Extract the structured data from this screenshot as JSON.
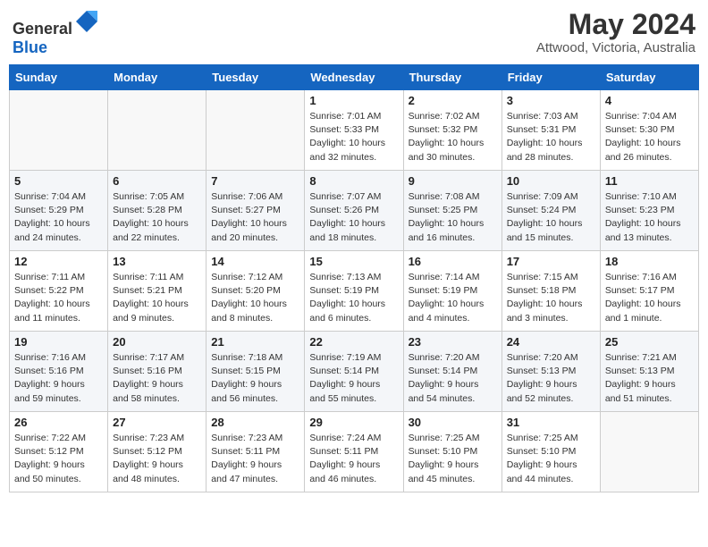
{
  "header": {
    "logo": {
      "general": "General",
      "blue": "Blue"
    },
    "month_year": "May 2024",
    "location": "Attwood, Victoria, Australia"
  },
  "days_of_week": [
    "Sunday",
    "Monday",
    "Tuesday",
    "Wednesday",
    "Thursday",
    "Friday",
    "Saturday"
  ],
  "weeks": [
    [
      {
        "day": "",
        "sunrise": "",
        "sunset": "",
        "daylight": "",
        "empty": true
      },
      {
        "day": "",
        "sunrise": "",
        "sunset": "",
        "daylight": "",
        "empty": true
      },
      {
        "day": "",
        "sunrise": "",
        "sunset": "",
        "daylight": "",
        "empty": true
      },
      {
        "day": "1",
        "sunrise": "Sunrise: 7:01 AM",
        "sunset": "Sunset: 5:33 PM",
        "daylight": "Daylight: 10 hours and 32 minutes.",
        "empty": false
      },
      {
        "day": "2",
        "sunrise": "Sunrise: 7:02 AM",
        "sunset": "Sunset: 5:32 PM",
        "daylight": "Daylight: 10 hours and 30 minutes.",
        "empty": false
      },
      {
        "day": "3",
        "sunrise": "Sunrise: 7:03 AM",
        "sunset": "Sunset: 5:31 PM",
        "daylight": "Daylight: 10 hours and 28 minutes.",
        "empty": false
      },
      {
        "day": "4",
        "sunrise": "Sunrise: 7:04 AM",
        "sunset": "Sunset: 5:30 PM",
        "daylight": "Daylight: 10 hours and 26 minutes.",
        "empty": false
      }
    ],
    [
      {
        "day": "5",
        "sunrise": "Sunrise: 7:04 AM",
        "sunset": "Sunset: 5:29 PM",
        "daylight": "Daylight: 10 hours and 24 minutes.",
        "empty": false
      },
      {
        "day": "6",
        "sunrise": "Sunrise: 7:05 AM",
        "sunset": "Sunset: 5:28 PM",
        "daylight": "Daylight: 10 hours and 22 minutes.",
        "empty": false
      },
      {
        "day": "7",
        "sunrise": "Sunrise: 7:06 AM",
        "sunset": "Sunset: 5:27 PM",
        "daylight": "Daylight: 10 hours and 20 minutes.",
        "empty": false
      },
      {
        "day": "8",
        "sunrise": "Sunrise: 7:07 AM",
        "sunset": "Sunset: 5:26 PM",
        "daylight": "Daylight: 10 hours and 18 minutes.",
        "empty": false
      },
      {
        "day": "9",
        "sunrise": "Sunrise: 7:08 AM",
        "sunset": "Sunset: 5:25 PM",
        "daylight": "Daylight: 10 hours and 16 minutes.",
        "empty": false
      },
      {
        "day": "10",
        "sunrise": "Sunrise: 7:09 AM",
        "sunset": "Sunset: 5:24 PM",
        "daylight": "Daylight: 10 hours and 15 minutes.",
        "empty": false
      },
      {
        "day": "11",
        "sunrise": "Sunrise: 7:10 AM",
        "sunset": "Sunset: 5:23 PM",
        "daylight": "Daylight: 10 hours and 13 minutes.",
        "empty": false
      }
    ],
    [
      {
        "day": "12",
        "sunrise": "Sunrise: 7:11 AM",
        "sunset": "Sunset: 5:22 PM",
        "daylight": "Daylight: 10 hours and 11 minutes.",
        "empty": false
      },
      {
        "day": "13",
        "sunrise": "Sunrise: 7:11 AM",
        "sunset": "Sunset: 5:21 PM",
        "daylight": "Daylight: 10 hours and 9 minutes.",
        "empty": false
      },
      {
        "day": "14",
        "sunrise": "Sunrise: 7:12 AM",
        "sunset": "Sunset: 5:20 PM",
        "daylight": "Daylight: 10 hours and 8 minutes.",
        "empty": false
      },
      {
        "day": "15",
        "sunrise": "Sunrise: 7:13 AM",
        "sunset": "Sunset: 5:19 PM",
        "daylight": "Daylight: 10 hours and 6 minutes.",
        "empty": false
      },
      {
        "day": "16",
        "sunrise": "Sunrise: 7:14 AM",
        "sunset": "Sunset: 5:19 PM",
        "daylight": "Daylight: 10 hours and 4 minutes.",
        "empty": false
      },
      {
        "day": "17",
        "sunrise": "Sunrise: 7:15 AM",
        "sunset": "Sunset: 5:18 PM",
        "daylight": "Daylight: 10 hours and 3 minutes.",
        "empty": false
      },
      {
        "day": "18",
        "sunrise": "Sunrise: 7:16 AM",
        "sunset": "Sunset: 5:17 PM",
        "daylight": "Daylight: 10 hours and 1 minute.",
        "empty": false
      }
    ],
    [
      {
        "day": "19",
        "sunrise": "Sunrise: 7:16 AM",
        "sunset": "Sunset: 5:16 PM",
        "daylight": "Daylight: 9 hours and 59 minutes.",
        "empty": false
      },
      {
        "day": "20",
        "sunrise": "Sunrise: 7:17 AM",
        "sunset": "Sunset: 5:16 PM",
        "daylight": "Daylight: 9 hours and 58 minutes.",
        "empty": false
      },
      {
        "day": "21",
        "sunrise": "Sunrise: 7:18 AM",
        "sunset": "Sunset: 5:15 PM",
        "daylight": "Daylight: 9 hours and 56 minutes.",
        "empty": false
      },
      {
        "day": "22",
        "sunrise": "Sunrise: 7:19 AM",
        "sunset": "Sunset: 5:14 PM",
        "daylight": "Daylight: 9 hours and 55 minutes.",
        "empty": false
      },
      {
        "day": "23",
        "sunrise": "Sunrise: 7:20 AM",
        "sunset": "Sunset: 5:14 PM",
        "daylight": "Daylight: 9 hours and 54 minutes.",
        "empty": false
      },
      {
        "day": "24",
        "sunrise": "Sunrise: 7:20 AM",
        "sunset": "Sunset: 5:13 PM",
        "daylight": "Daylight: 9 hours and 52 minutes.",
        "empty": false
      },
      {
        "day": "25",
        "sunrise": "Sunrise: 7:21 AM",
        "sunset": "Sunset: 5:13 PM",
        "daylight": "Daylight: 9 hours and 51 minutes.",
        "empty": false
      }
    ],
    [
      {
        "day": "26",
        "sunrise": "Sunrise: 7:22 AM",
        "sunset": "Sunset: 5:12 PM",
        "daylight": "Daylight: 9 hours and 50 minutes.",
        "empty": false
      },
      {
        "day": "27",
        "sunrise": "Sunrise: 7:23 AM",
        "sunset": "Sunset: 5:12 PM",
        "daylight": "Daylight: 9 hours and 48 minutes.",
        "empty": false
      },
      {
        "day": "28",
        "sunrise": "Sunrise: 7:23 AM",
        "sunset": "Sunset: 5:11 PM",
        "daylight": "Daylight: 9 hours and 47 minutes.",
        "empty": false
      },
      {
        "day": "29",
        "sunrise": "Sunrise: 7:24 AM",
        "sunset": "Sunset: 5:11 PM",
        "daylight": "Daylight: 9 hours and 46 minutes.",
        "empty": false
      },
      {
        "day": "30",
        "sunrise": "Sunrise: 7:25 AM",
        "sunset": "Sunset: 5:10 PM",
        "daylight": "Daylight: 9 hours and 45 minutes.",
        "empty": false
      },
      {
        "day": "31",
        "sunrise": "Sunrise: 7:25 AM",
        "sunset": "Sunset: 5:10 PM",
        "daylight": "Daylight: 9 hours and 44 minutes.",
        "empty": false
      },
      {
        "day": "",
        "sunrise": "",
        "sunset": "",
        "daylight": "",
        "empty": true
      }
    ]
  ]
}
